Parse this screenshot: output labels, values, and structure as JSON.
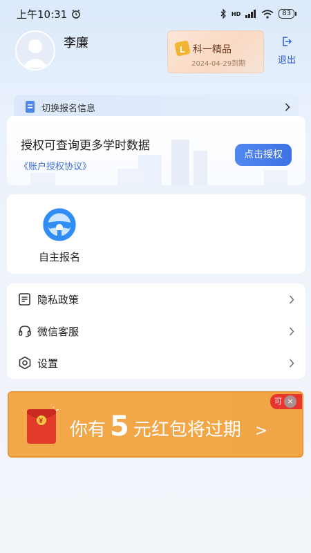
{
  "status_bar": {
    "time": "上午10:31",
    "network": "HD",
    "battery": "83"
  },
  "profile": {
    "user_name": "李廉"
  },
  "vip": {
    "title": "科一精品",
    "expiry": "2024-04-29到期"
  },
  "logout": {
    "label": "退出"
  },
  "switch": {
    "label": "切换报名信息"
  },
  "auth": {
    "title": "授权可查询更多学时数据",
    "link": "《账户授权协议》",
    "button": "点击授权"
  },
  "services": [
    {
      "label": "自主报名",
      "icon": "steering-wheel-icon"
    }
  ],
  "menu": [
    {
      "label": "隐私政策",
      "icon": "document-icon"
    },
    {
      "label": "微信客服",
      "icon": "headset-icon"
    },
    {
      "label": "设置",
      "icon": "hexagon-settings-icon"
    }
  ],
  "promo": {
    "prefix": "你有",
    "amount": "5",
    "suffix": "元红包将过期",
    "arrow": ">",
    "tag": "可",
    "close": "×"
  },
  "colors": {
    "accent": "#3d72e6",
    "promo": "#f1a545",
    "vip": "#f9d9c2"
  }
}
